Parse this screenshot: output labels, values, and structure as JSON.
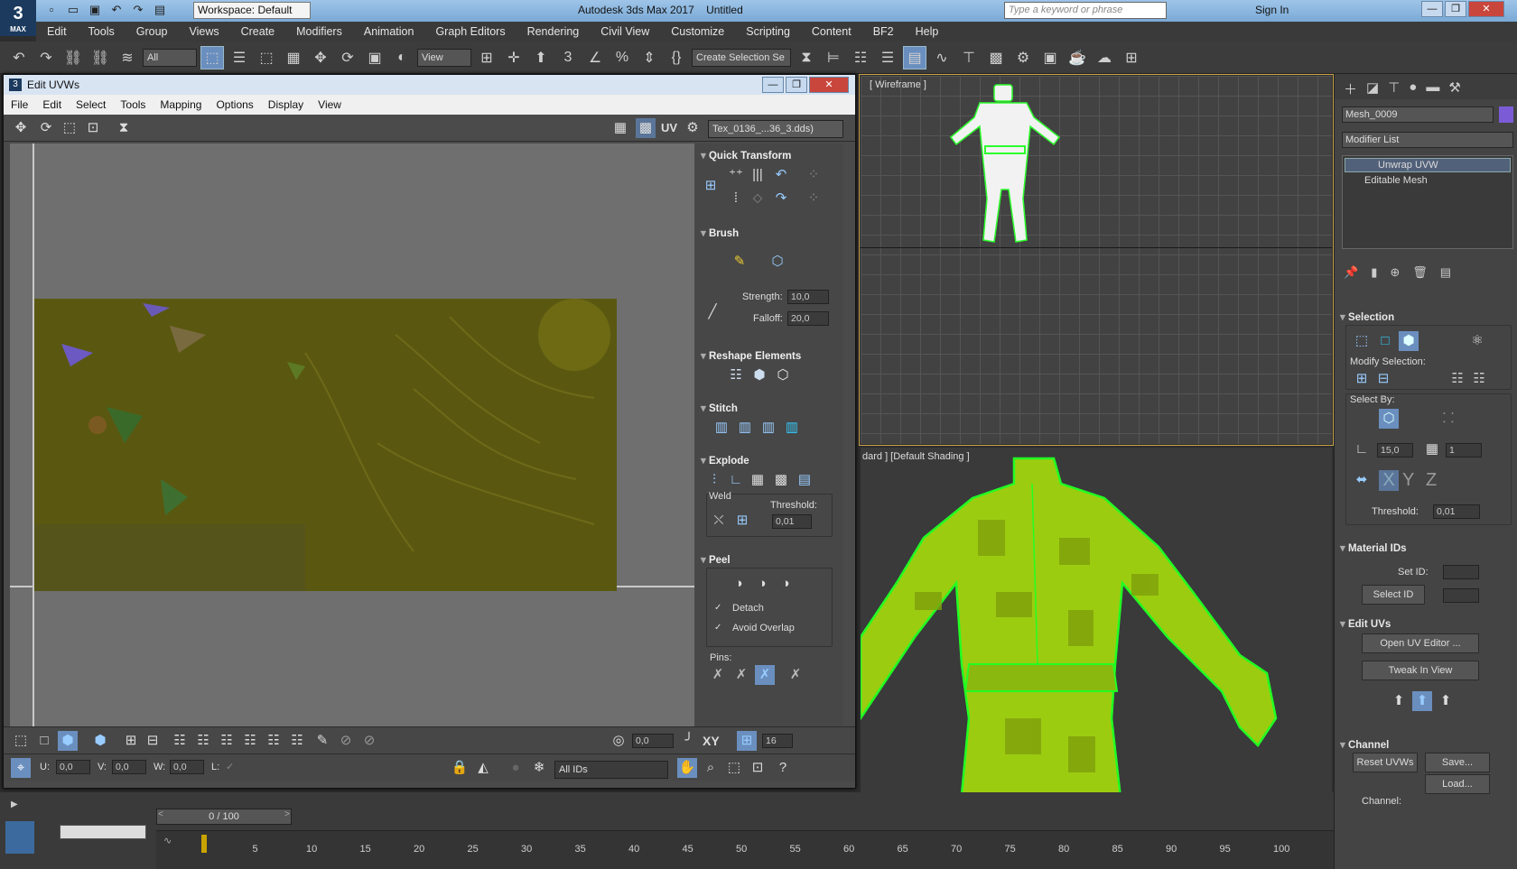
{
  "app": {
    "logo": "3",
    "logo_sub": "MAX",
    "workspace": "Workspace: Default",
    "title": "Autodesk 3ds Max 2017",
    "file": "Untitled",
    "search_placeholder": "Type a keyword or phrase",
    "sign_in": "Sign In"
  },
  "menu": [
    "Edit",
    "Tools",
    "Group",
    "Views",
    "Create",
    "Modifiers",
    "Animation",
    "Graph Editors",
    "Rendering",
    "Civil View",
    "Customize",
    "Scripting",
    "Content",
    "BF2",
    "Help"
  ],
  "toolbar": {
    "filter": "All",
    "view": "View",
    "selection_set": "Create Selection Se"
  },
  "viewports": {
    "top_label": "[ Wireframe ]",
    "persp_label": "dard ] [Default Shading ]"
  },
  "uvw": {
    "title": "Edit UVWs",
    "menu": [
      "File",
      "Edit",
      "Select",
      "Tools",
      "Mapping",
      "Options",
      "Display",
      "View"
    ],
    "uv_label": "UV",
    "texture": "Tex_0136_...36_3.dds)",
    "quick_transform": "Quick Transform",
    "brush": "Brush",
    "strength_label": "Strength:",
    "strength": "10,0",
    "falloff_label": "Falloff:",
    "falloff": "20,0",
    "reshape": "Reshape Elements",
    "stitch": "Stitch",
    "explode": "Explode",
    "weld": "Weld",
    "threshold_label": "Threshold:",
    "threshold": "0,01",
    "peel": "Peel",
    "detach": "Detach",
    "avoid_overlap": "Avoid Overlap",
    "pins": "Pins:",
    "rot_value": "0,0",
    "xy": "XY",
    "grid_value": "16",
    "u_label": "U:",
    "u": "0,0",
    "v_label": "V:",
    "v": "0,0",
    "w_label": "W:",
    "w": "0,0",
    "l_label": "L:",
    "ids": "All IDs"
  },
  "cmd": {
    "object": "Mesh_0009",
    "modifier_list": "Modifier List",
    "stack": [
      "Unwrap UVW",
      "Editable Mesh"
    ],
    "selection": "Selection",
    "modify_selection": "Modify Selection:",
    "select_by": "Select By:",
    "angle": "15,0",
    "count": "1",
    "axis_x": "X",
    "axis_y": "Y",
    "axis_z": "Z",
    "threshold_label": "Threshold:",
    "threshold": "0,01",
    "material_ids": "Material IDs",
    "set_id": "Set ID:",
    "select_id": "Select ID",
    "edit_uvs": "Edit UVs",
    "open_uv_editor": "Open UV Editor ...",
    "tweak_in_view": "Tweak In View",
    "channel": "Channel",
    "reset_uvws": "Reset UVWs",
    "save": "Save...",
    "load": "Load...",
    "channel_label": "Channel:"
  },
  "timeline": {
    "frame": "0 / 100",
    "ticks": [
      "5",
      "10",
      "15",
      "20",
      "25",
      "30",
      "35",
      "40",
      "45",
      "50",
      "55",
      "60",
      "65",
      "70",
      "75",
      "80",
      "85",
      "90",
      "95",
      "100"
    ]
  },
  "colors": {
    "accent": "#6a8fbf",
    "mesh": "#9ccc10",
    "outline": "#22ff22",
    "texture": "#5a5810"
  }
}
